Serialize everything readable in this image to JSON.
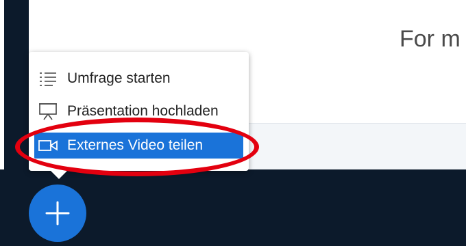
{
  "header": {
    "title": "For m"
  },
  "actions_menu": {
    "items": [
      {
        "label": "Umfrage starten",
        "icon": "list-icon"
      },
      {
        "label": "Präsentation hochladen",
        "icon": "presentation-icon"
      },
      {
        "label": "Externes Video teilen",
        "icon": "video-camera-icon",
        "selected": true
      }
    ]
  },
  "fab": {
    "icon": "plus-icon"
  },
  "colors": {
    "accent": "#1a73d9",
    "dark_background": "#0c1a2b",
    "annotation_red": "#e3000f"
  }
}
